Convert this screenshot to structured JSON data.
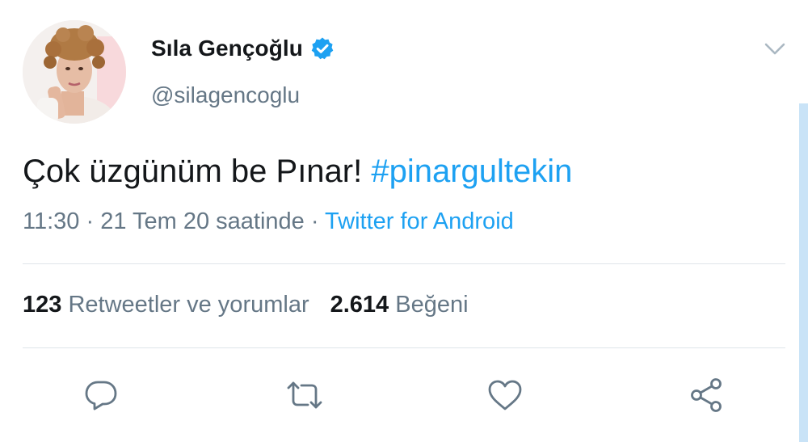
{
  "tweet": {
    "author": {
      "display_name": "Sıla Gençoğlu",
      "handle": "@silagencoglu",
      "verified": true
    },
    "text": "Çok üzgünüm be Pınar! ",
    "hashtag": "#pinargultekin",
    "time": "11:30",
    "date": "21 Tem 20 saatinde",
    "separator": " · ",
    "source": "Twitter for Android",
    "stats": {
      "retweets_count": "123",
      "retweets_label": "Retweetler ve yorumlar",
      "likes_count": "2.614",
      "likes_label": "Beğeni"
    }
  },
  "icons": {
    "verified": "verified-badge-icon",
    "menu": "chevron-down-icon",
    "reply": "reply-icon",
    "retweet": "retweet-icon",
    "like": "heart-icon",
    "share": "share-icon"
  },
  "colors": {
    "accent": "#1da1f2",
    "text_primary": "#14171a",
    "text_secondary": "#657786",
    "divider": "#dfe5ea",
    "scroll_accent": "#c9e3f7"
  }
}
